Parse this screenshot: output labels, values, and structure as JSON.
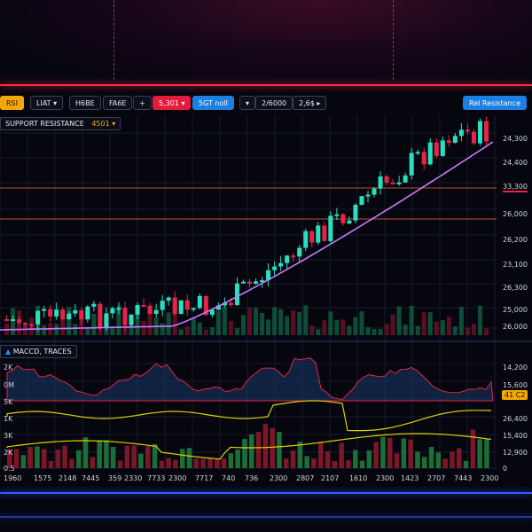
{
  "toolbar": {
    "rsi_label": "RSI",
    "list_label": "LIAT ▾",
    "b2_label": "H6BE",
    "b3_label": "FA6E",
    "plus_label": "+",
    "price_label": "5,301 ▾",
    "b5_label": "5GT noll",
    "chevron_label": "▾",
    "range_label": "2/6000",
    "b7_label": "2,6$ ▸",
    "right_label": "Rel Resistance"
  },
  "main_panel": {
    "label": "SUPPORT  RESISTANCE",
    "badge": "4501 ▾",
    "y_labels": [
      "24,300",
      "24,400",
      "33,300",
      "26,000",
      "26,200",
      "23,100",
      "26,300",
      "25,000",
      "26,000"
    ]
  },
  "macd_panel": {
    "label": "MACCD, TRACES",
    "y_left": [
      "2K",
      "0M",
      "5K",
      "1K",
      "3K",
      "2K",
      "0.5"
    ],
    "y_right": [
      "14,200",
      "15,600",
      "26,400",
      "15,400",
      "12,900",
      "0"
    ],
    "highlight": "41 C2"
  },
  "x_labels": [
    "1960",
    "1575",
    "2148",
    "7445",
    "359",
    "2330",
    "7733",
    "2300",
    "7717",
    "740",
    "736",
    "2300",
    "2807",
    "2107",
    "1610",
    "2300",
    "1423",
    "2707",
    "7443",
    "2300"
  ],
  "colors": {
    "up": "#28e0c0",
    "down": "#e8234a",
    "ma": "#c879ff",
    "macd_line": "#e0d000",
    "accent_red": "#ff2a4a",
    "accent_blue": "#2f5bff"
  }
}
